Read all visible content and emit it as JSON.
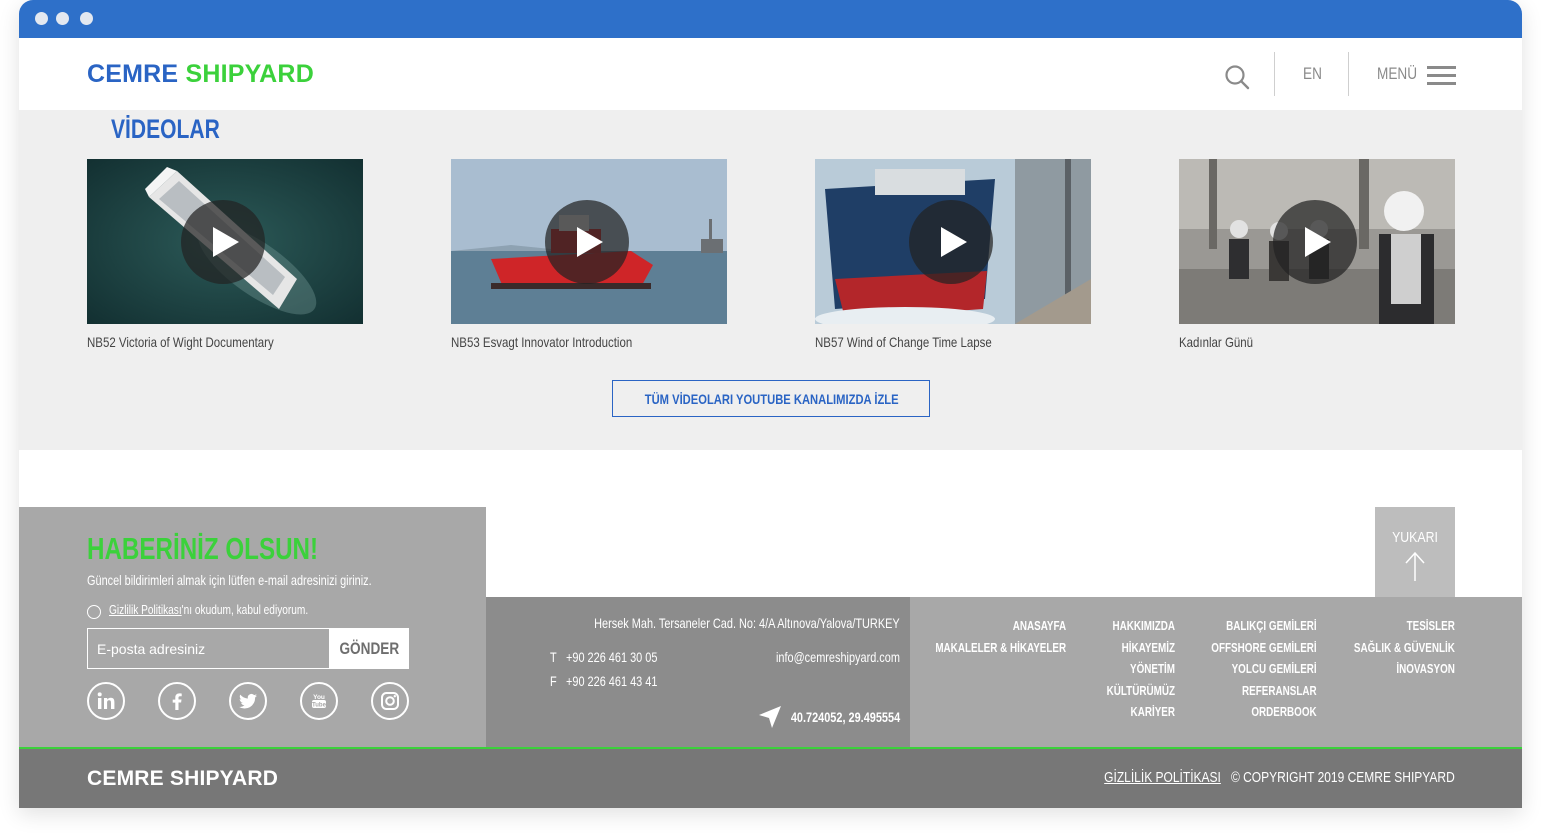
{
  "brand": {
    "name_part1": "CEMRE",
    "name_part2": "SHIPYARD",
    "footer_name": "CEMRE SHIPYARD"
  },
  "header": {
    "lang": "EN",
    "menu_label": "MENÜ"
  },
  "videos": {
    "title": "VİDEOLAR",
    "items": [
      {
        "caption": "NB52 Victoria of Wight Documentary"
      },
      {
        "caption": "NB53 Esvagt Innovator Introduction"
      },
      {
        "caption": "NB57 Wind of Change Time Lapse"
      },
      {
        "caption": "Kadınlar Günü"
      }
    ],
    "youtube_button": "TÜM VİDEOLARI YOUTUBE KANALIMIZDA İZLE"
  },
  "newsletter": {
    "title": "HABERİNİZ OLSUN!",
    "subtitle": "Güncel bildirimleri almak için lütfen e-mail adresinizi giriniz.",
    "consent_link": "Gizlilik Politikası",
    "consent_rest": "'nı okudum, kabul ediyorum.",
    "email_placeholder": "E-posta adresiniz",
    "send_label": "GÖNDER"
  },
  "back_to_top": "YUKARI",
  "contact": {
    "address": "Hersek Mah. Tersaneler Cad. No: 4/A Altınova/Yalova/TURKEY",
    "phone_label": "T",
    "phone": "+90 226 461 30 05",
    "fax_label": "F",
    "fax": "+90 226 461 43 41",
    "email": "info@cemreshipyard.com",
    "coordinates": "40.724052, 29.495554"
  },
  "footer_links": {
    "col1": [
      "ANASAYFA",
      "MAKALELER & HİKAYELER"
    ],
    "col2": [
      "HAKKIMIZDA",
      "HİKAYEMİZ",
      "YÖNETİM",
      "KÜLTÜRÜMÜZ",
      "KARİYER"
    ],
    "col3": [
      "BALIKÇI GEMİLERİ",
      "OFFSHORE GEMİLERİ",
      "YOLCU GEMİLERİ",
      "REFERANSLAR",
      "ORDERBOOK"
    ],
    "col4": [
      "TESİSLER",
      "SAĞLIK & GÜVENLİK",
      "İNOVASYON"
    ]
  },
  "bottom": {
    "privacy": "GİZLİLİK POLİTİKASI",
    "copyright": "© COPYRIGHT 2019 CEMRE SHIPYARD"
  },
  "colors": {
    "chrome": "#2e70c9",
    "brand_blue": "#2a64c4",
    "brand_green": "#3bd13b"
  }
}
